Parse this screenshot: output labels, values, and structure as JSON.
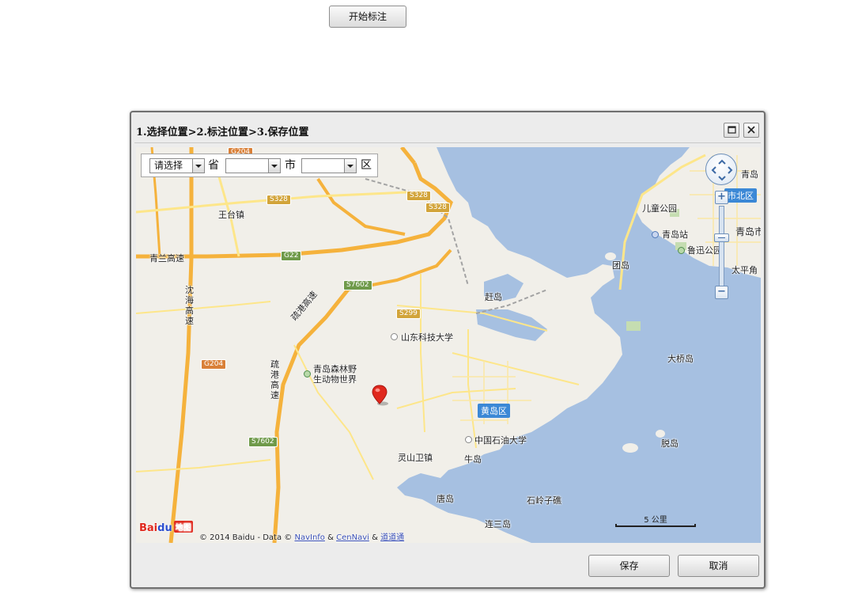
{
  "start_button": "开始标注",
  "dialog": {
    "title": "1.选择位置>2.标注位置>3.保存位置",
    "maximize_icon": "maximize-icon",
    "close_icon": "close-icon",
    "save_label": "保存",
    "cancel_label": "取消"
  },
  "region_selector": {
    "province_value": "请选择",
    "province_unit": "省",
    "city_value": "",
    "city_unit": "市",
    "district_value": "",
    "district_unit": "区"
  },
  "map": {
    "labels": {
      "wangtai": "王台镇",
      "qinglan": "青兰高速",
      "shenhai": "沈海高速",
      "liugang": "疏港高速",
      "liugang2": "疏港高速",
      "kedi": "山东科技大学",
      "senlin1": "青岛森林野",
      "senlin2": "生动物世界",
      "huangdao": "黄岛区",
      "shiyou": "中国石油大学",
      "lingshan": "灵山卫镇",
      "niudao": "牛岛",
      "tangdao": "唐岛",
      "shiling": "石岭子礁",
      "liansan": "连三岛",
      "zhaodao": "赶岛",
      "tuandao": "团岛",
      "daqiao": "大桥岛",
      "tuodao": "脱岛",
      "ertong": "儿童公园",
      "qingdaozhan": "青岛站",
      "luxun": "鲁迅公园",
      "taiping": "太平角",
      "qingdao": "青岛",
      "qingdaoshi": "青岛市",
      "shibei": "市北区"
    },
    "shields": {
      "s328a": "S328",
      "s328b": "S328",
      "s328c": "S328",
      "g22": "G22",
      "s7602a": "S7602",
      "s7602b": "S7602",
      "s299": "S299",
      "g204a": "G204",
      "g204b": "G204"
    },
    "scale_label": "5 公里",
    "copyright": {
      "prefix": "© 2014 Baidu - Data ©",
      "navinfo": "NavInfo",
      "amp1": "&",
      "cennavi": "CenNavi",
      "amp2": "&",
      "daodaotong": "道道通"
    },
    "logo": {
      "bai": "Bai",
      "du": "du",
      "ditu": "地图"
    },
    "zoom_in": "+",
    "zoom_out": "−",
    "marker_icon": "map-pin-icon",
    "colors": {
      "sea": "#a6c0e1",
      "land": "#f1efe9",
      "highway": "#f5b23c",
      "road": "#fde68a",
      "marker": "#e0281d"
    }
  }
}
